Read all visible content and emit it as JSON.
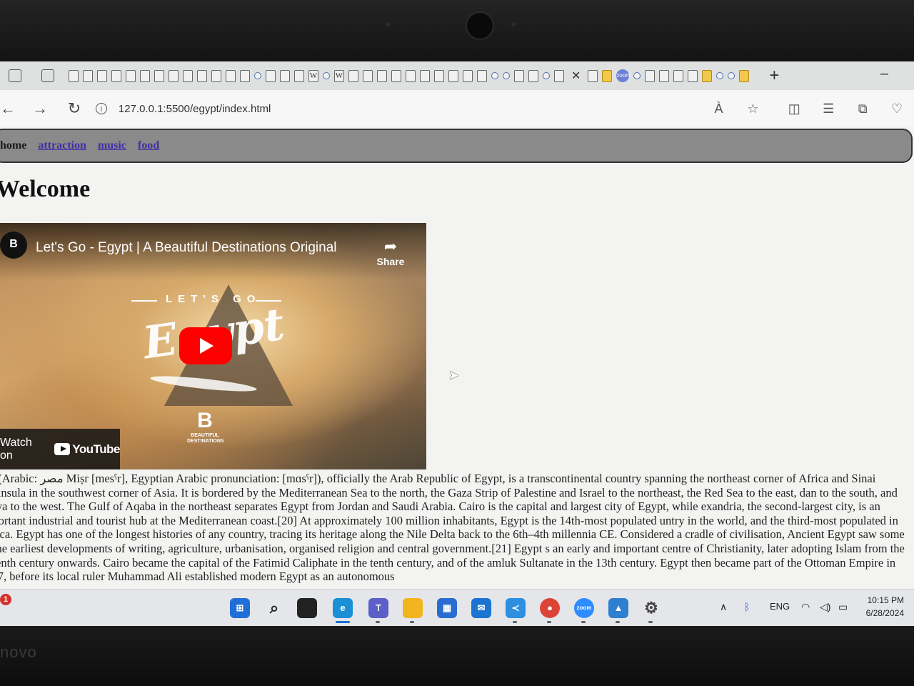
{
  "browser": {
    "url": "127.0.0.1:5500/egypt/index.html",
    "read_aloud_label": "À"
  },
  "nav": {
    "home": "home",
    "links": [
      "attraction",
      "music",
      "food"
    ]
  },
  "heading": "Welcome",
  "video": {
    "channel_initial": "B",
    "title": "Let's Go - Egypt | A Beautiful Destinations Original",
    "share_label": "Share",
    "overlay_top": "LET'S GO",
    "overlay_script": "Egypt",
    "brand_letter": "B",
    "brand_text_1": "BEAUTIFUL",
    "brand_text_2": "DESTINATIONS",
    "watch_on": "Watch on",
    "youtube": "YouTube"
  },
  "article": "ypt (Arabic: مصر Miṣr [mesˤr], Egyptian Arabic pronunciation: [mɑsˤr]), officially the Arab Republic of Egypt, is a transcontinental country spanning the northeast corner of Africa and Sinai Peninsula in the southwest corner of Asia. It is bordered by the Mediterranean Sea to the north, the Gaza Strip of Palestine and Israel to the northeast, the Red Sea to the east, dan to the south, and Libya to the west. The Gulf of Aqaba in the northeast separates Egypt from Jordan and Saudi Arabia. Cairo is the capital and largest city of Egypt, while exandria, the second-largest city, is an important industrial and tourist hub at the Mediterranean coast.[20] At approximately 100 million inhabitants, Egypt is the 14th-most populated untry in the world, and the third-most populated in Africa. Egypt has one of the longest histories of any country, tracing its heritage along the Nile Delta back to the 6th–4th millennia CE. Considered a cradle of civilisation, Ancient Egypt saw some of the earliest developments of writing, agriculture, urbanisation, organised religion and central government.[21] Egypt s an early and important centre of Christianity, later adopting Islam from the seventh century onwards. Cairo became the capital of the Fatimid Caliphate in the tenth century, and of the amluk Sultanate in the 13th century. Egypt then became part of the Ottoman Empire in 1517, before its local ruler Muhammad Ali established modern Egypt as an autonomous",
  "taskbar": {
    "notification_count": "1",
    "language": "ENG",
    "time": "10:15 PM",
    "date": "6/28/2024",
    "zoom_label": "zoom"
  },
  "laptop_brand": "novo"
}
